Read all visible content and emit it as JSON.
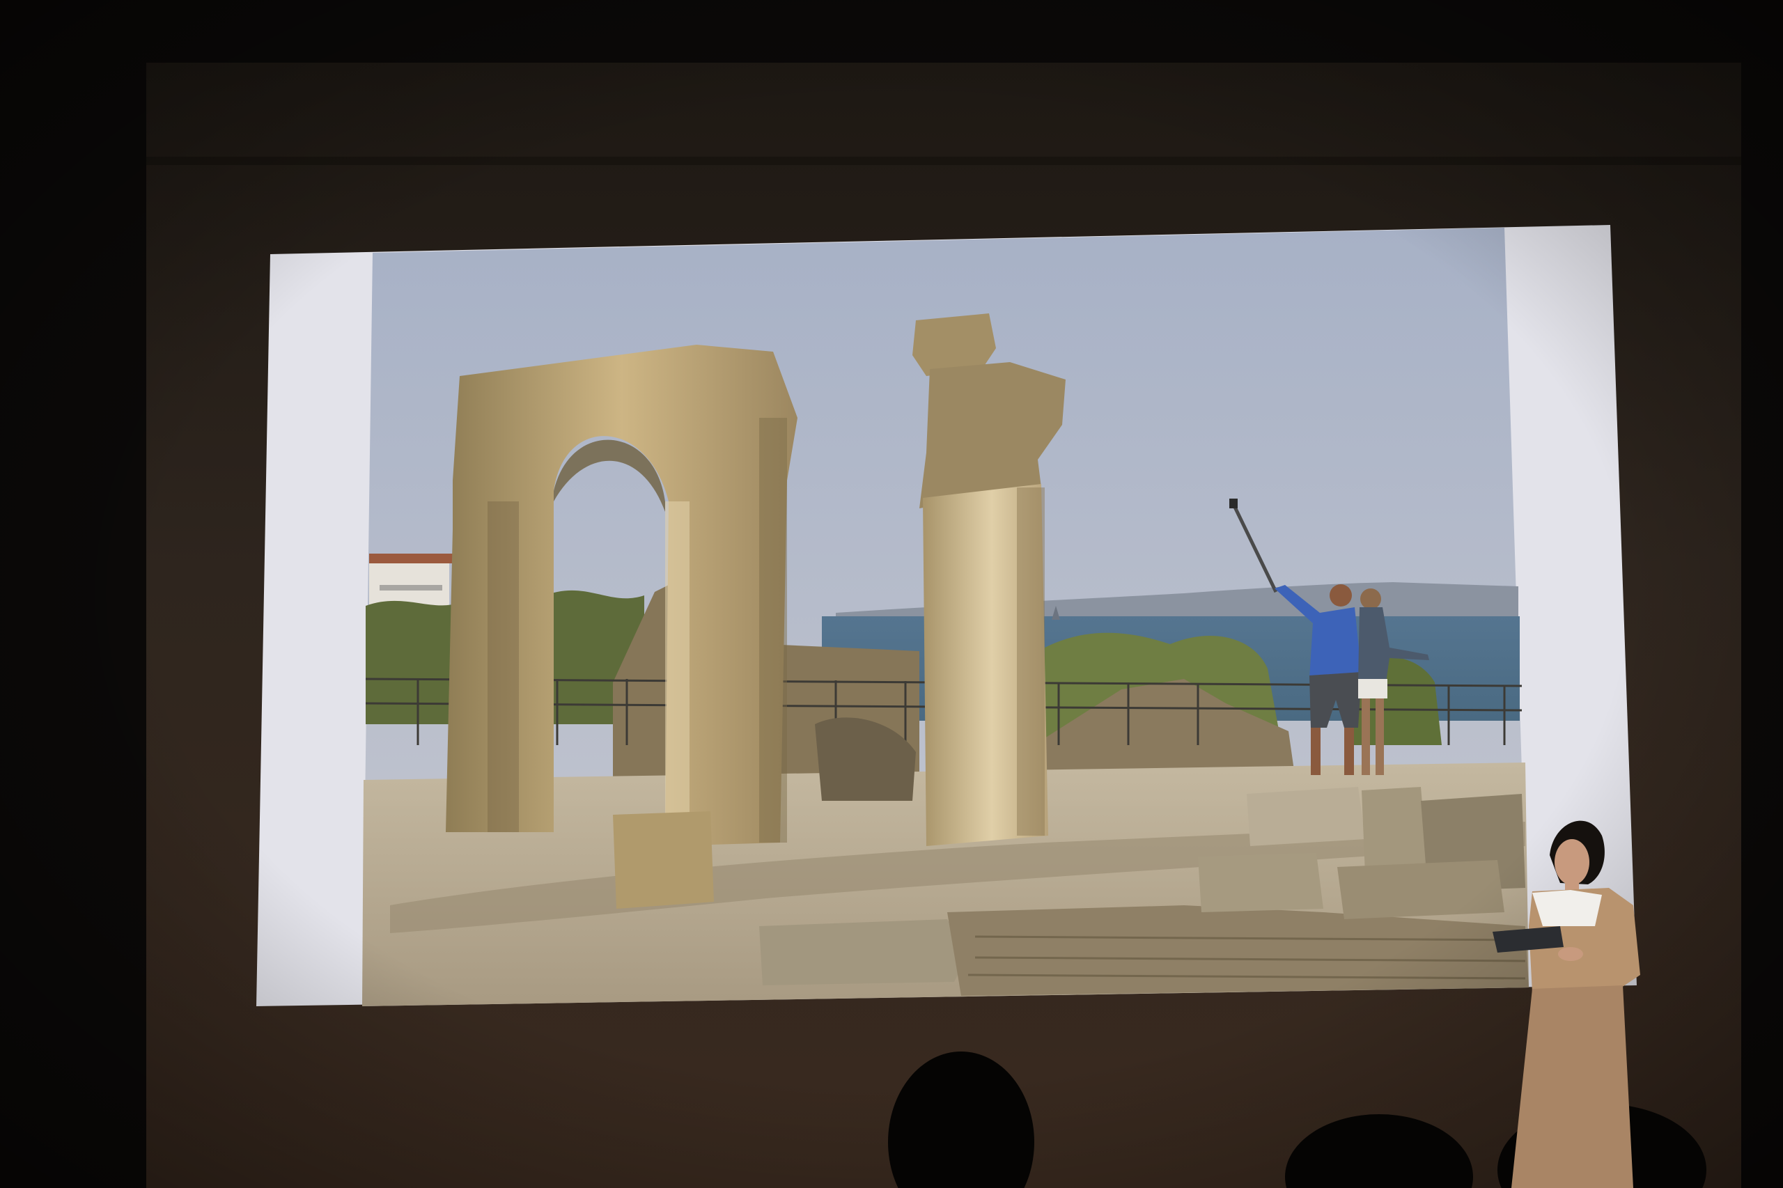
{
  "scene": {
    "kind": "presentation-photo",
    "colors": {
      "room": "#0b0908",
      "wall": "#2b231d",
      "slide_margin": "#e4e4ea",
      "sky_top": "#a9b3c7",
      "sky_bottom": "#c3c5cf",
      "lake": "#4e6d88",
      "stone": "#c9b17c",
      "ground": "#bdb19a",
      "presenter_dress": "#b8936e",
      "presenter_shirt": "#f1efeb"
    },
    "icons": {
      "selfie_stick": "selfie-stick-icon",
      "tablet": "tablet-icon"
    }
  }
}
